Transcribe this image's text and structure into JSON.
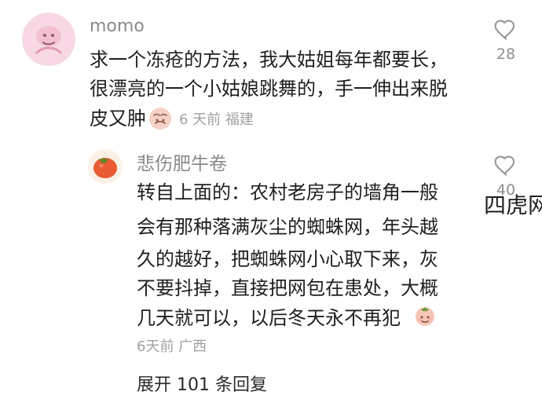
{
  "comments": [
    {
      "username": "momo",
      "lines": [
        "求一个冻疮的方法，我大姑姐每年都要长，",
        "很漂亮的一个小姑娘跳舞的，手一伸出来脱",
        "皮又肿"
      ],
      "meta": "6 天前 福建",
      "likes": "28",
      "emoji_icon": "sad-face-emoji-icon"
    },
    {
      "username": "悲伤肥牛卷",
      "lines": [
        "转自上面的：农村老房子的墙角一般",
        "会有那种落满灰尘的蜘蛛网，年头越",
        "久的越好，把蜘蛛网小心取下来，灰",
        "不要抖掉，直接把网包在患处，大概",
        "几天就可以，以后冬天永不再犯"
      ],
      "meta": "6天前 广西",
      "likes": "40",
      "emoji_icon": "peach-face-emoji-icon"
    }
  ],
  "expand_label": "展开 101 条回复",
  "watermark_text": "四虎网",
  "icons": {
    "main_avatar": "avatar-icon",
    "reply_avatar": "tomato-avatar-icon",
    "like": "heart-icon"
  },
  "colors": {
    "text": "#1f1f1f",
    "meta": "#a1a1a1",
    "username": "#8a8a8a",
    "like": "#9a9a9a"
  }
}
